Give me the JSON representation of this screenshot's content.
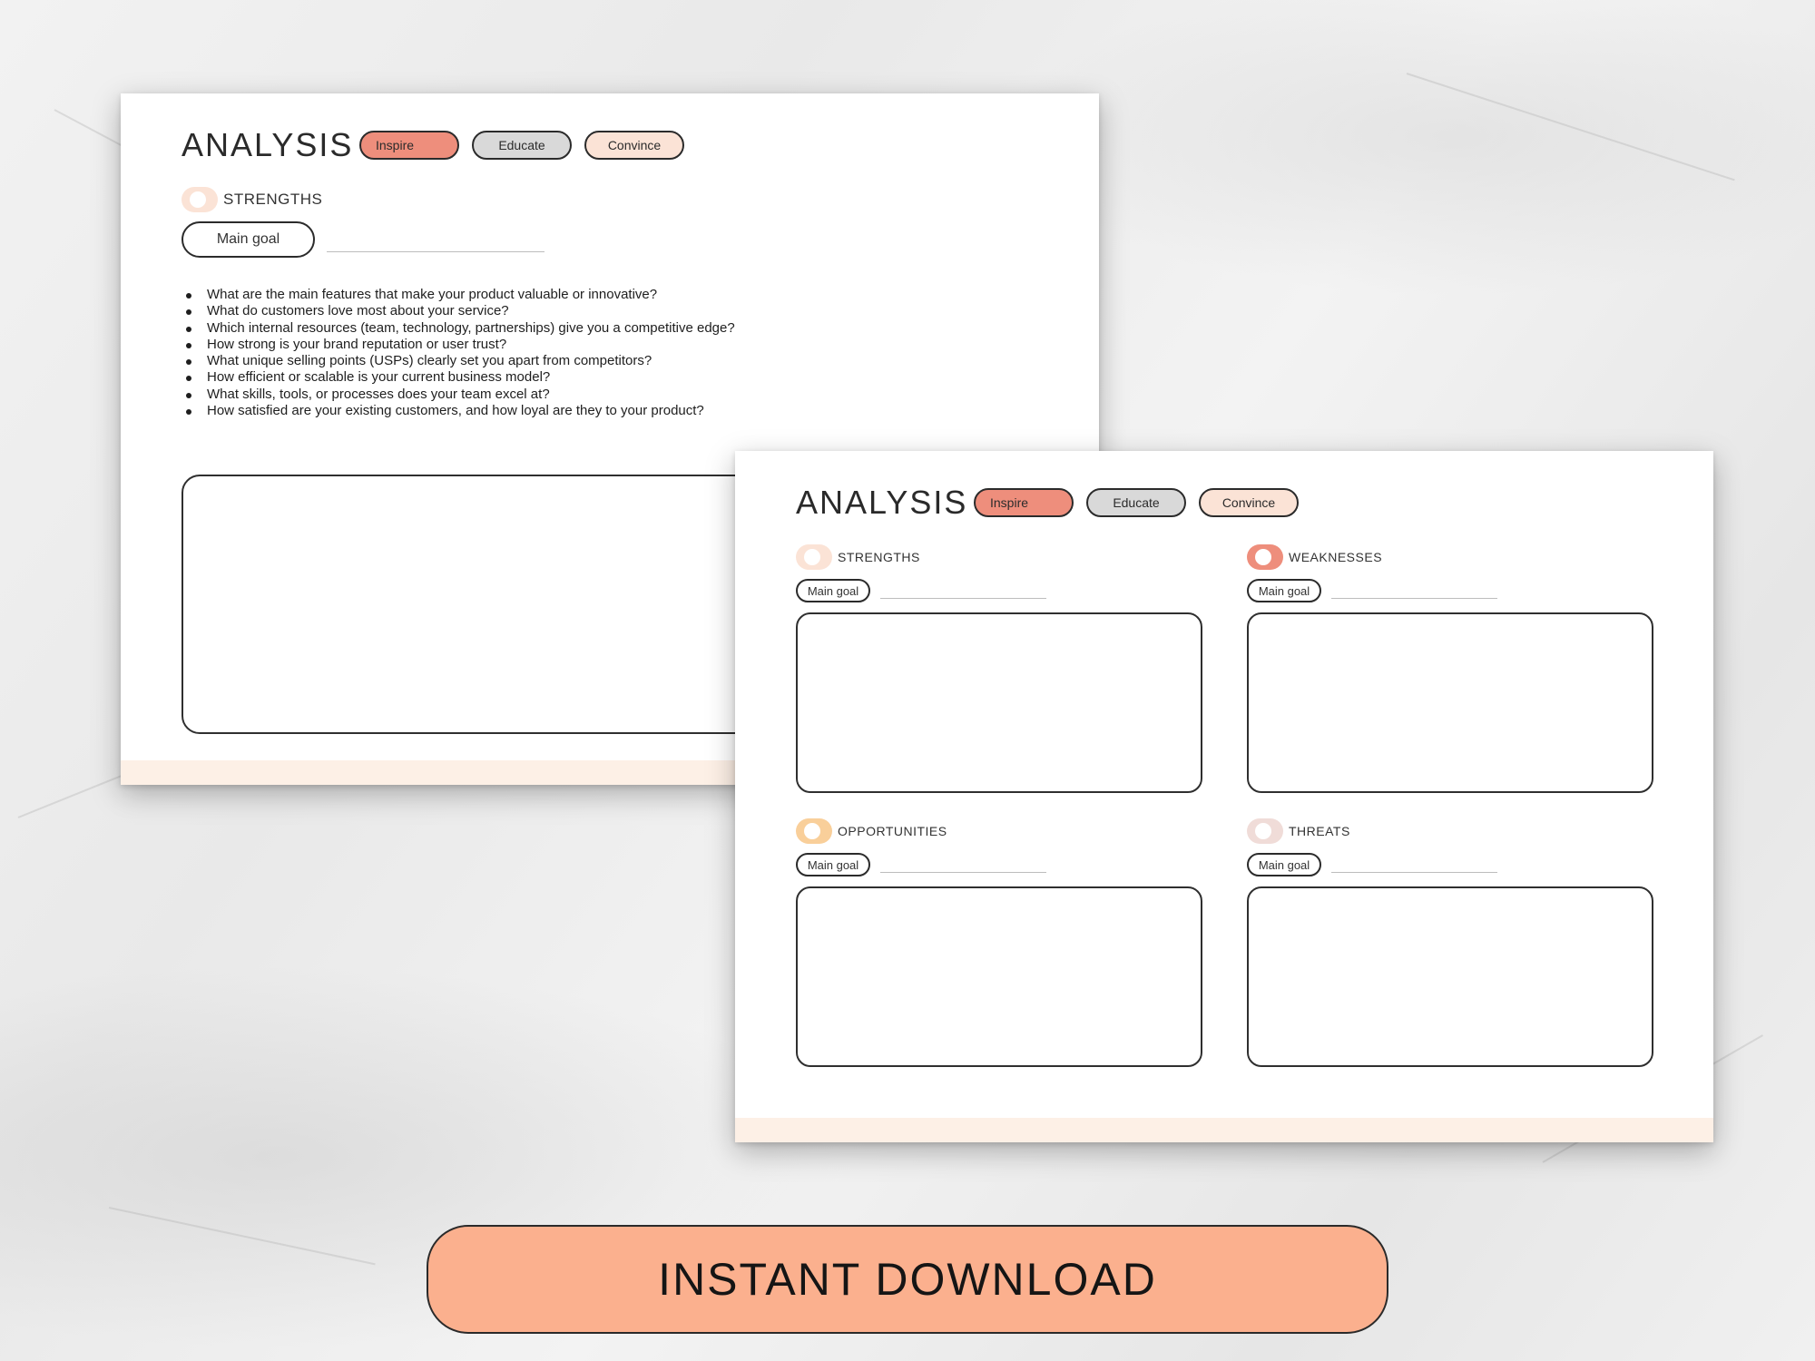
{
  "back_page": {
    "title": "ANALYSIS",
    "tags": {
      "inspire": "Inspire",
      "educate": "Educate",
      "convince": "Convince"
    },
    "section": {
      "label": "STRENGTHS",
      "goal_label": "Main goal"
    },
    "questions": [
      "What are the main features that make your product valuable or innovative?",
      "What do customers love most about your service?",
      "Which internal resources (team, technology, partnerships) give you a competitive edge?",
      "How strong is your brand reputation or user trust?",
      "What unique selling points (USPs) clearly set you apart from competitors?",
      "How efficient or scalable is your current business model?",
      "What skills, tools, or processes does your team excel at?",
      "How satisfied are your existing customers, and how loyal are they to your product?"
    ]
  },
  "front_page": {
    "title": "ANALYSIS",
    "tags": {
      "inspire": "Inspire",
      "educate": "Educate",
      "convince": "Convince"
    },
    "sections": [
      {
        "label": "STRENGTHS",
        "goal_label": "Main goal",
        "color": "#fbe3d6"
      },
      {
        "label": "WEAKNESSES",
        "goal_label": "Main goal",
        "color": "#ee8e7c"
      },
      {
        "label": "OPPORTUNITIES",
        "goal_label": "Main goal",
        "color": "#f9cf9a"
      },
      {
        "label": "THREATS",
        "goal_label": "Main goal",
        "color": "#f0dcd8"
      }
    ]
  },
  "colors": {
    "inspire": "#ee8e7c",
    "educate": "#d9d9d9",
    "convince": "#fbe3d6",
    "footer": "#fdf0e6",
    "download_button": "#fbb08e"
  },
  "banner": {
    "label": "INSTANT DOWNLOAD"
  }
}
